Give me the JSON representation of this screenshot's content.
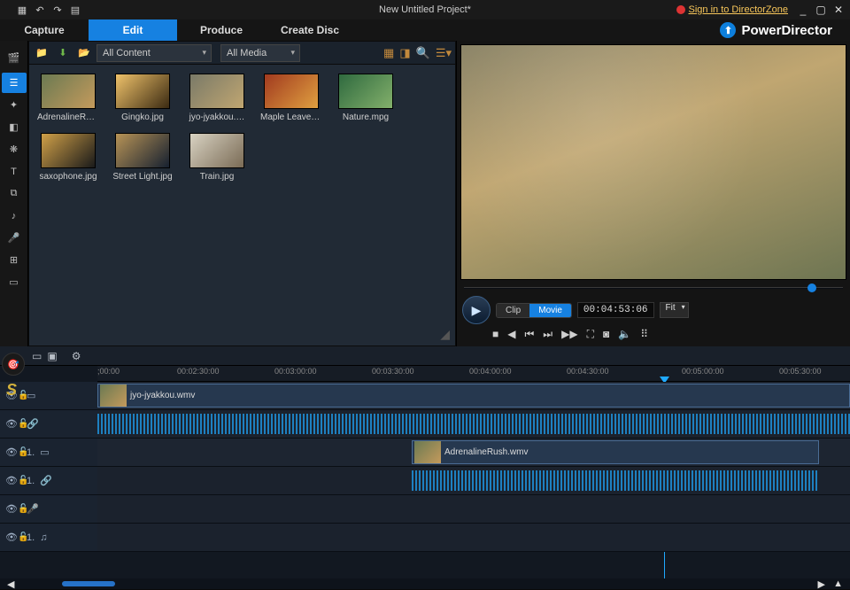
{
  "titlebar": {
    "title": "New Untitled Project*",
    "signin": "Sign in to DirectorZone"
  },
  "app_name": "PowerDirector",
  "modes": [
    "Capture",
    "Edit",
    "Produce",
    "Create Disc"
  ],
  "mode_active_index": 1,
  "library": {
    "content_filter": "All Content",
    "media_filter": "All Media",
    "items": [
      "AdrenalineRush…",
      "Gingko.jpg",
      "jyo-jyakkou.…",
      "Maple Leaves…",
      "Nature.mpg",
      "saxophone.jpg",
      "Street Light.jpg",
      "Train.jpg"
    ]
  },
  "preview": {
    "pill_clip": "Clip",
    "pill_movie": "Movie",
    "timecode": "00:04:53:06",
    "fit_label": "Fit"
  },
  "timeline": {
    "ticks": [
      {
        "label": ";00:00",
        "pos": 0
      },
      {
        "label": "00:02:30:00",
        "pos": 90
      },
      {
        "label": "00:03:00:00",
        "pos": 200
      },
      {
        "label": "00:03:30:00",
        "pos": 310
      },
      {
        "label": "00:04:00:00",
        "pos": 420
      },
      {
        "label": "00:04:30:00",
        "pos": 530
      },
      {
        "label": "00:05:00:00",
        "pos": 660
      },
      {
        "label": "00:05:30:00",
        "pos": 770
      }
    ],
    "clip1": "jyo-jyakkou.wmv",
    "clip2": "AdrenalineRush.wmv",
    "track_labels": {
      "v1": "",
      "a1": "",
      "v2": "1.",
      "a2": "1.",
      "a3": "",
      "a4": "1."
    }
  }
}
